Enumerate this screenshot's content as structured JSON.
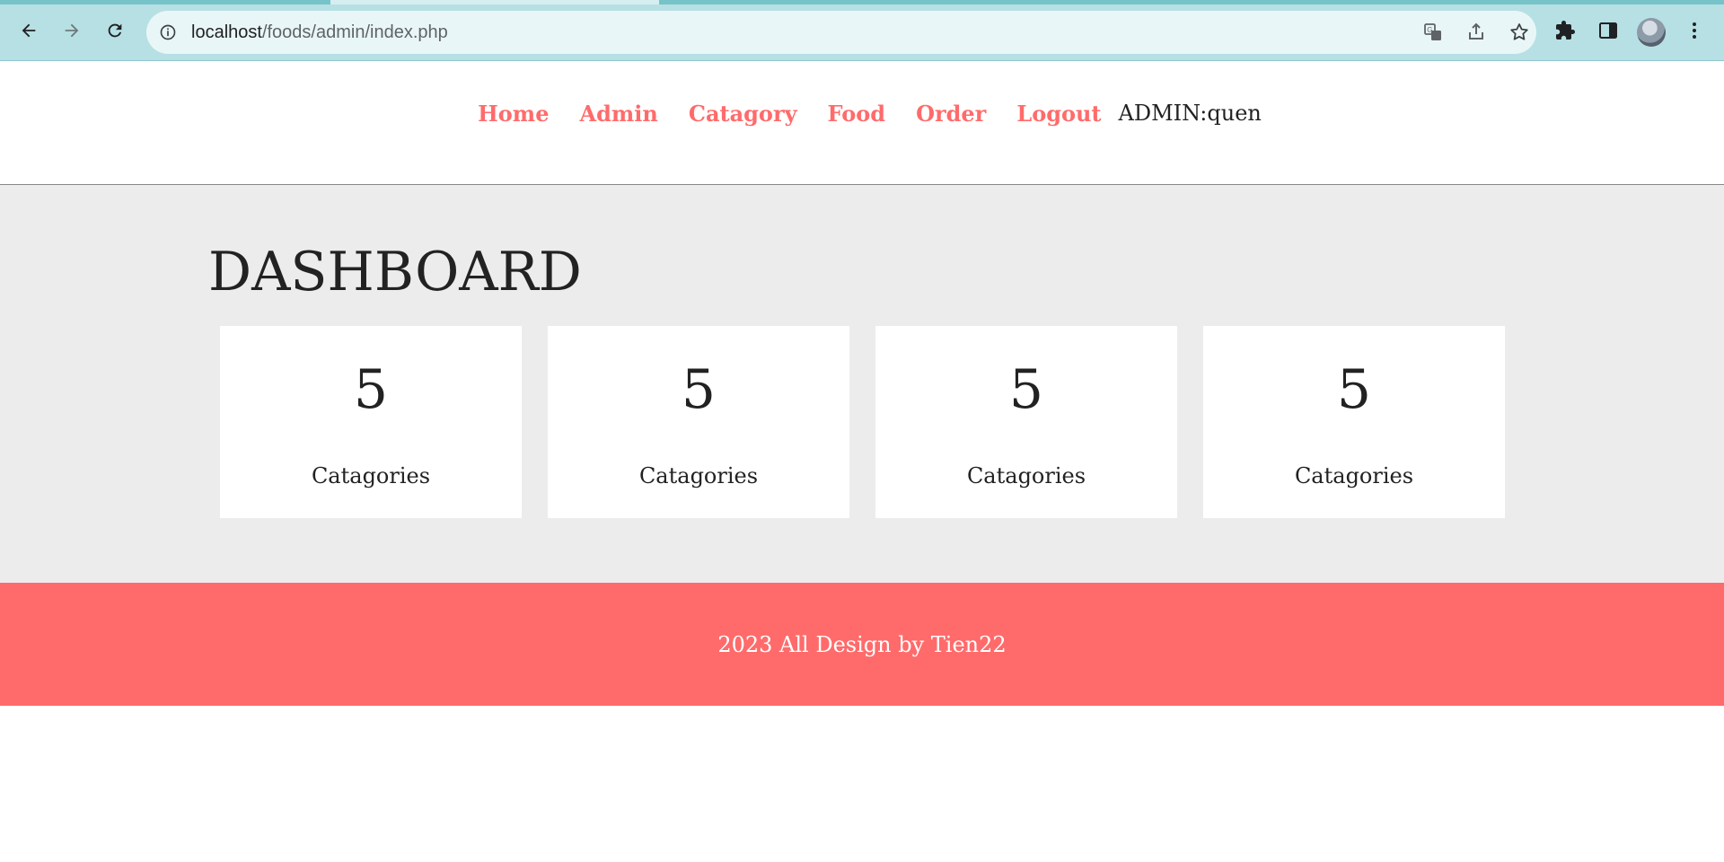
{
  "browser": {
    "url_host": "localhost",
    "url_path": "/foods/admin/index.php",
    "icons": [
      "back-icon",
      "forward-icon",
      "reload-icon",
      "site-info-icon",
      "translate-icon",
      "share-icon",
      "bookmark-star-icon",
      "extensions-icon",
      "side-panel-icon",
      "profile-avatar",
      "menu-kebab-icon"
    ]
  },
  "nav": {
    "items": [
      {
        "label": "Home"
      },
      {
        "label": "Admin"
      },
      {
        "label": "Catagory"
      },
      {
        "label": "Food"
      },
      {
        "label": "Order"
      },
      {
        "label": "Logout"
      }
    ],
    "admin_user": "ADMIN:quen",
    "link_color": "#ff6b6b"
  },
  "main": {
    "title": "DASHBOARD",
    "cards": [
      {
        "count": "5",
        "label": "Catagories"
      },
      {
        "count": "5",
        "label": "Catagories"
      },
      {
        "count": "5",
        "label": "Catagories"
      },
      {
        "count": "5",
        "label": "Catagories"
      }
    ],
    "background": "#ececec"
  },
  "footer": {
    "text": "2023 All Design by Tien22",
    "background": "#ff6b6b"
  }
}
